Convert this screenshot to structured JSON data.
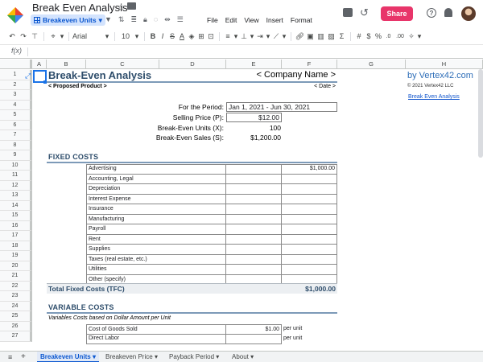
{
  "app": {
    "doc_title": "Break Even Analysis",
    "active_sheet_pill": "Breakeven Units",
    "menus": [
      "File",
      "Edit",
      "View",
      "Insert",
      "Format"
    ],
    "share_label": "Share"
  },
  "toolbar": {
    "font": "Arial",
    "font_size": "10",
    "currency": "$",
    "percent": "%",
    "dec_dec": ".0",
    "dec_inc": ".00"
  },
  "formula": {
    "fx": "f(x)"
  },
  "columns": [
    "A",
    "B",
    "C",
    "D",
    "E",
    "F",
    "G",
    "H"
  ],
  "rows": [
    "1",
    "2",
    "3",
    "4",
    "5",
    "6",
    "7",
    "8",
    "9",
    "10",
    "11",
    "12",
    "13",
    "14",
    "15",
    "16",
    "17",
    "18",
    "19",
    "20",
    "21",
    "22",
    "23",
    "24",
    "25",
    "26",
    "27"
  ],
  "sheet": {
    "title": "Break-Even Analysis",
    "subtitle": "< Proposed Product >",
    "company": "< Company Name >",
    "date": "< Date >",
    "brand": "by Vertex42.com",
    "copyright": "© 2021 Vertex42 LLC",
    "link": "Break Even Analysis",
    "params": {
      "period_label": "For the Period:",
      "period_value": "Jan 1, 2021 - Jun 30, 2021",
      "price_label": "Selling Price (P):",
      "price_value": "$12.00",
      "units_label": "Break-Even Units (X):",
      "units_value": "100",
      "sales_label": "Break-Even Sales (S):",
      "sales_value": "$1,200.00"
    },
    "fixed_title": "FIXED COSTS",
    "fixed_items": [
      {
        "name": "Advertising",
        "amount": "$1,000.00"
      },
      {
        "name": "Accounting, Legal",
        "amount": ""
      },
      {
        "name": "Depreciation",
        "amount": ""
      },
      {
        "name": "Interest Expense",
        "amount": ""
      },
      {
        "name": "Insurance",
        "amount": ""
      },
      {
        "name": "Manufacturing",
        "amount": ""
      },
      {
        "name": "Payroll",
        "amount": ""
      },
      {
        "name": "Rent",
        "amount": ""
      },
      {
        "name": "Supplies",
        "amount": ""
      },
      {
        "name": "Taxes (real estate, etc.)",
        "amount": ""
      },
      {
        "name": "Utilities",
        "amount": ""
      },
      {
        "name": "Other (specify)",
        "amount": ""
      }
    ],
    "total_fixed_label": "Total Fixed Costs (TFC)",
    "total_fixed_value": "$1,000.00",
    "variable_title": "VARIABLE COSTS",
    "variable_note": "Variables Costs based on Dollar Amount per Unit",
    "variable_items": [
      {
        "name": "Cost of Goods Sold",
        "amount": "$1.00",
        "unit": "per unit"
      },
      {
        "name": "Direct Labor",
        "amount": "",
        "unit": "per unit"
      }
    ]
  },
  "tabs": [
    {
      "label": "Breakeven Units",
      "active": true
    },
    {
      "label": "Breakeven Price",
      "active": false
    },
    {
      "label": "Payback Period",
      "active": false
    },
    {
      "label": "About",
      "active": false
    }
  ],
  "colors": {
    "accent": "#0b57d0",
    "share": "#e8356a",
    "heading": "#2e4d6b",
    "brand_link": "#2e6eb8"
  }
}
